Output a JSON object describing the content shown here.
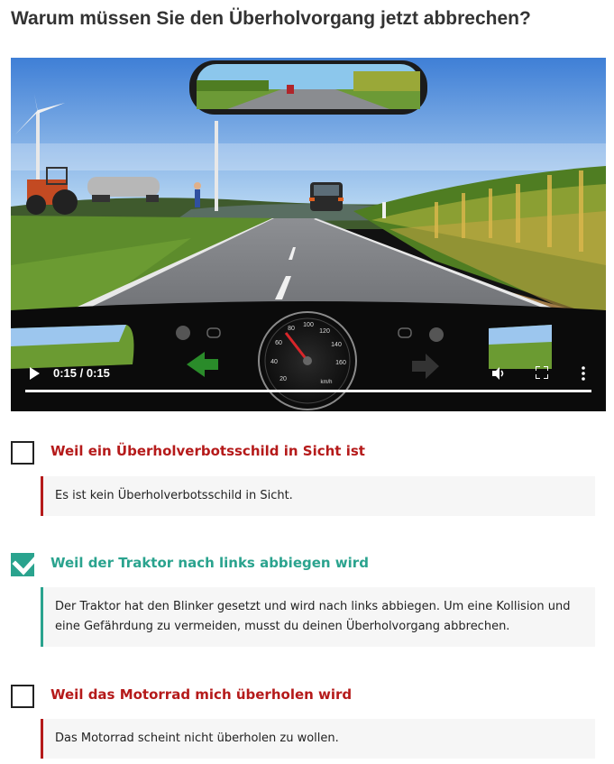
{
  "question": "Warum müssen Sie den Überholvorgang jetzt abbrechen?",
  "video": {
    "time": "0:15 / 0:15",
    "speedometer_numbers": [
      "20",
      "40",
      "60",
      "80",
      "100",
      "120",
      "140",
      "160"
    ],
    "speed_unit": "km/h",
    "progress": 1.0
  },
  "colors": {
    "wrong": "#b51a1a",
    "correct": "#2aa38e"
  },
  "options": [
    {
      "label": "Weil ein Überholverbotsschild in Sicht ist",
      "checked": false,
      "correct": false,
      "feedback": "Es ist kein Überholverbotsschild in Sicht."
    },
    {
      "label": "Weil der Traktor nach links abbiegen wird",
      "checked": true,
      "correct": true,
      "feedback": "Der Traktor hat den Blinker gesetzt und wird nach links abbiegen. Um eine Kollision und eine Gefährdung zu vermeiden, musst du deinen Überholvorgang abbrechen."
    },
    {
      "label": "Weil das Motorrad mich überholen wird",
      "checked": false,
      "correct": false,
      "feedback": "Das Motorrad scheint nicht überholen zu wollen."
    }
  ]
}
